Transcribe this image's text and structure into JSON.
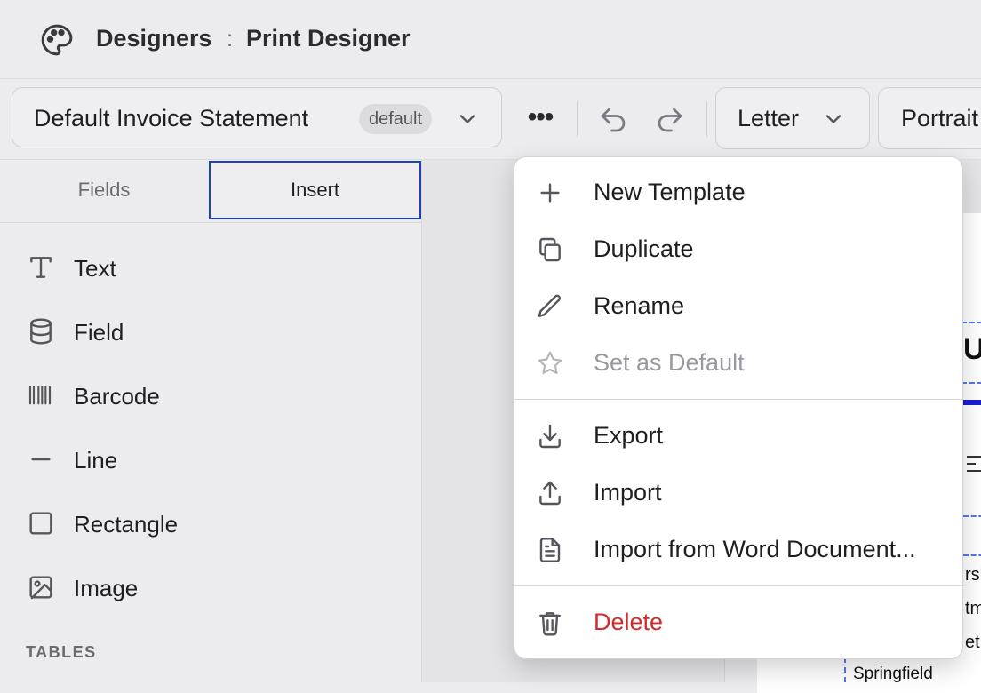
{
  "header": {
    "breadcrumb_parent": "Designers",
    "breadcrumb_sep": ":",
    "breadcrumb_current": "Print Designer",
    "icon": "palette-icon"
  },
  "toolbar": {
    "template_name": "Default Invoice Statement",
    "template_badge": "default",
    "more_label": "•••",
    "page_size": "Letter",
    "orientation": "Portrait"
  },
  "left_panel": {
    "tabs": [
      {
        "label": "Fields",
        "active": false
      },
      {
        "label": "Insert",
        "active": true
      }
    ],
    "insert_items": [
      {
        "label": "Text",
        "icon": "text-icon"
      },
      {
        "label": "Field",
        "icon": "database-icon"
      },
      {
        "label": "Barcode",
        "icon": "barcode-icon"
      },
      {
        "label": "Line",
        "icon": "line-icon"
      },
      {
        "label": "Rectangle",
        "icon": "rectangle-icon"
      },
      {
        "label": "Image",
        "icon": "image-icon"
      }
    ],
    "tables_heading": "TABLES"
  },
  "canvas": {
    "fragments": [
      "U",
      "rsi",
      "tm",
      "et",
      "Springfield"
    ]
  },
  "menu": {
    "items": [
      {
        "label": "New Template",
        "icon": "plus-icon",
        "state": "normal"
      },
      {
        "label": "Duplicate",
        "icon": "copy-icon",
        "state": "normal"
      },
      {
        "label": "Rename",
        "icon": "pencil-icon",
        "state": "normal"
      },
      {
        "label": "Set as Default",
        "icon": "star-icon",
        "state": "disabled"
      },
      {
        "label": "Export",
        "icon": "download-icon",
        "state": "normal"
      },
      {
        "label": "Import",
        "icon": "upload-icon",
        "state": "normal"
      },
      {
        "label": "Import from Word Document...",
        "icon": "document-icon",
        "state": "normal"
      },
      {
        "label": "Delete",
        "icon": "trash-icon",
        "state": "danger"
      }
    ]
  },
  "colors": {
    "accent": "#1b43b3",
    "danger": "#d12b2b",
    "background": "#ececee"
  }
}
